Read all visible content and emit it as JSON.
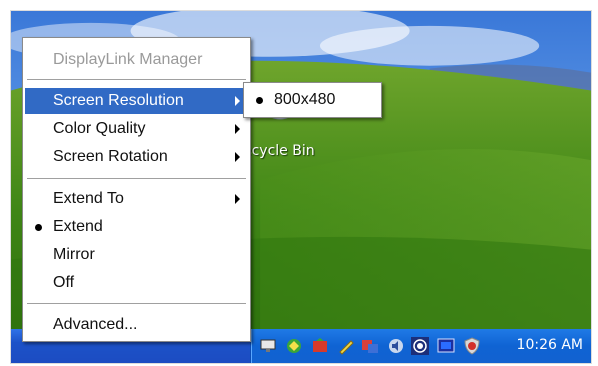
{
  "desktop": {
    "recycle_bin_label": "ecycle Bin"
  },
  "menu": {
    "items": [
      {
        "label": "DisplayLink Manager",
        "state": "disabled"
      },
      {
        "label": "Screen Resolution",
        "state": "highlighted",
        "submenu": true
      },
      {
        "label": "Color Quality",
        "submenu": true
      },
      {
        "label": "Screen Rotation",
        "submenu": true
      },
      {
        "label": "Extend To",
        "submenu": true
      },
      {
        "label": "Extend",
        "checked": true
      },
      {
        "label": "Mirror"
      },
      {
        "label": "Off"
      },
      {
        "label": "Advanced..."
      }
    ]
  },
  "submenu": {
    "items": [
      {
        "label": "800x480",
        "checked": true
      }
    ]
  },
  "taskbar": {
    "clock": "10:26 AM",
    "tray_icons": [
      "monitor-icon",
      "network-icon",
      "security-icon",
      "tool-icon",
      "display-icon",
      "volume-icon",
      "wireless-icon",
      "screen-icon",
      "shield-icon"
    ]
  },
  "colors": {
    "highlight": "#316ac5",
    "taskbar": "#1c52c8",
    "tray": "#0f63d3"
  }
}
